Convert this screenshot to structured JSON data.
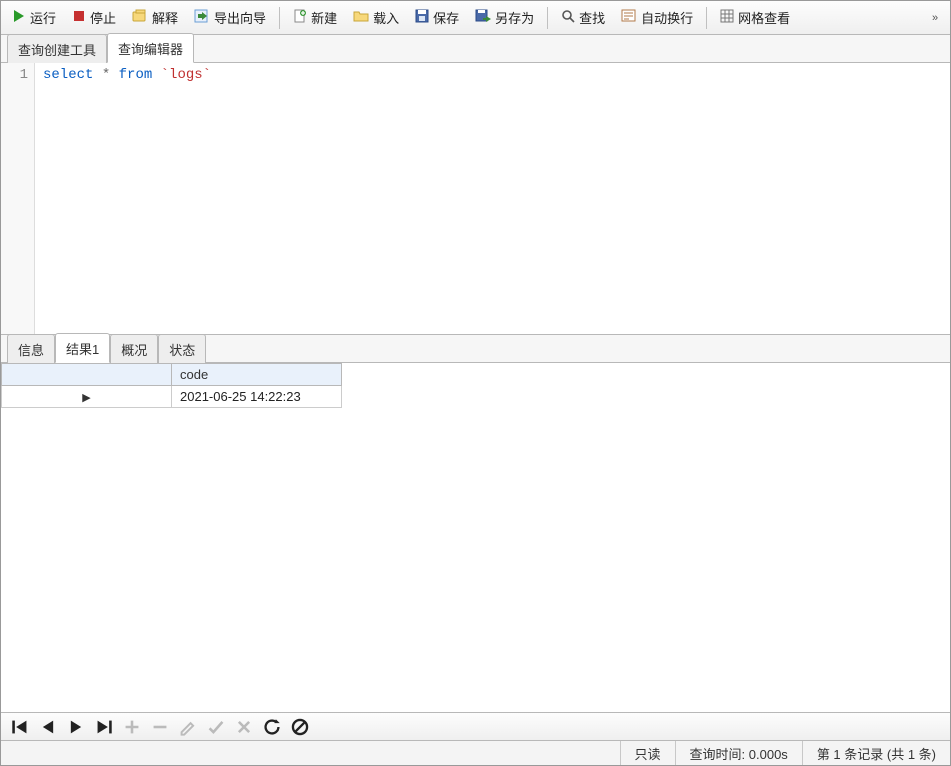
{
  "toolbar": {
    "run": "运行",
    "stop": "停止",
    "explain": "解释",
    "export_wizard": "导出向导",
    "new": "新建",
    "load": "载入",
    "save": "保存",
    "save_as": "另存为",
    "find": "查找",
    "word_wrap": "自动换行",
    "grid_view": "网格查看"
  },
  "editor_tabs": {
    "builder": "查询创建工具",
    "editor": "查询编辑器"
  },
  "sql": {
    "line_no": "1",
    "keyword_select": "select",
    "star": "*",
    "keyword_from": "from",
    "ident": "`logs`"
  },
  "result_tabs": {
    "messages": "信息",
    "result1": "结果1",
    "profile": "概况",
    "status": "状态"
  },
  "grid": {
    "columns": [
      "code"
    ],
    "rows": [
      {
        "code": "2021-06-25 14:22:23"
      }
    ]
  },
  "statusbar": {
    "readonly": "只读",
    "query_time": "查询时间: 0.000s",
    "record": "第 1 条记录 (共 1 条)"
  }
}
